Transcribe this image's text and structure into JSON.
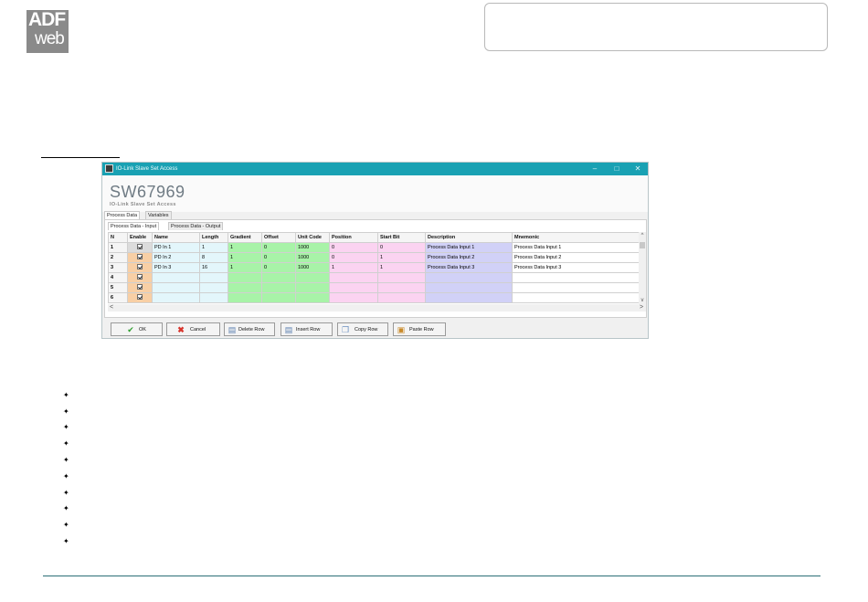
{
  "logo": {
    "line1": "ADF",
    "line2": "web"
  },
  "window": {
    "title": "IO-Link Slave Set Access",
    "controls": {
      "minimize": "–",
      "maximize": "□",
      "close": "✕"
    },
    "code": "SW67969",
    "subtitle": "IO-Link Slave Set Access",
    "main_tabs": [
      "Process Data",
      "Variables"
    ],
    "sub_tabs": [
      "Process Data - Input",
      "Process Data - Output"
    ],
    "table": {
      "headers": [
        "N",
        "Enable",
        "Name",
        "Length",
        "Gradient",
        "Offset",
        "Unit Code",
        "Position",
        "Start Bit",
        "Description",
        "Mnemonic"
      ],
      "rows": [
        {
          "n": "1",
          "name": "PD In 1",
          "length": "1",
          "gradient": "1",
          "offset": "0",
          "unit": "1000",
          "position": "0",
          "startbit": "0",
          "desc": "Process Data Input 1",
          "mnem": "Process Data Input 1"
        },
        {
          "n": "2",
          "name": "PD In 2",
          "length": "8",
          "gradient": "1",
          "offset": "0",
          "unit": "1000",
          "position": "0",
          "startbit": "1",
          "desc": "Process Data Input 2",
          "mnem": "Process Data Input 2"
        },
        {
          "n": "3",
          "name": "PD In 3",
          "length": "16",
          "gradient": "1",
          "offset": "0",
          "unit": "1000",
          "position": "1",
          "startbit": "1",
          "desc": "Process Data Input 3",
          "mnem": "Process Data Input 3"
        },
        {
          "n": "4",
          "name": "",
          "length": "",
          "gradient": "",
          "offset": "",
          "unit": "",
          "position": "",
          "startbit": "",
          "desc": "",
          "mnem": ""
        },
        {
          "n": "5",
          "name": "",
          "length": "",
          "gradient": "",
          "offset": "",
          "unit": "",
          "position": "",
          "startbit": "",
          "desc": "",
          "mnem": ""
        },
        {
          "n": "6",
          "name": "",
          "length": "",
          "gradient": "",
          "offset": "",
          "unit": "",
          "position": "",
          "startbit": "",
          "desc": "",
          "mnem": ""
        }
      ]
    },
    "scroll": {
      "up": "^",
      "down": "v",
      "left": "<",
      "right": ">"
    },
    "buttons": {
      "ok": "OK",
      "cancel": "Cancel",
      "delete_row": "Delete Row",
      "insert_row": "Insert Row",
      "copy_row": "Copy Row",
      "paste_row": "Paste Row"
    }
  },
  "bullet_glyph": "✦",
  "bullets": [
    "",
    "",
    "",
    "",
    "",
    "",
    "",
    "",
    "",
    ""
  ],
  "colors": {
    "titlebar": "#19a1b3",
    "enable_col": "#f8cfa5",
    "name_col": "#e3f6fb",
    "green_cols": "#a8f3a8",
    "pink_cols": "#fbd3f1",
    "desc_col": "#d1d1f7",
    "footer_rule": "#2b6f77"
  }
}
